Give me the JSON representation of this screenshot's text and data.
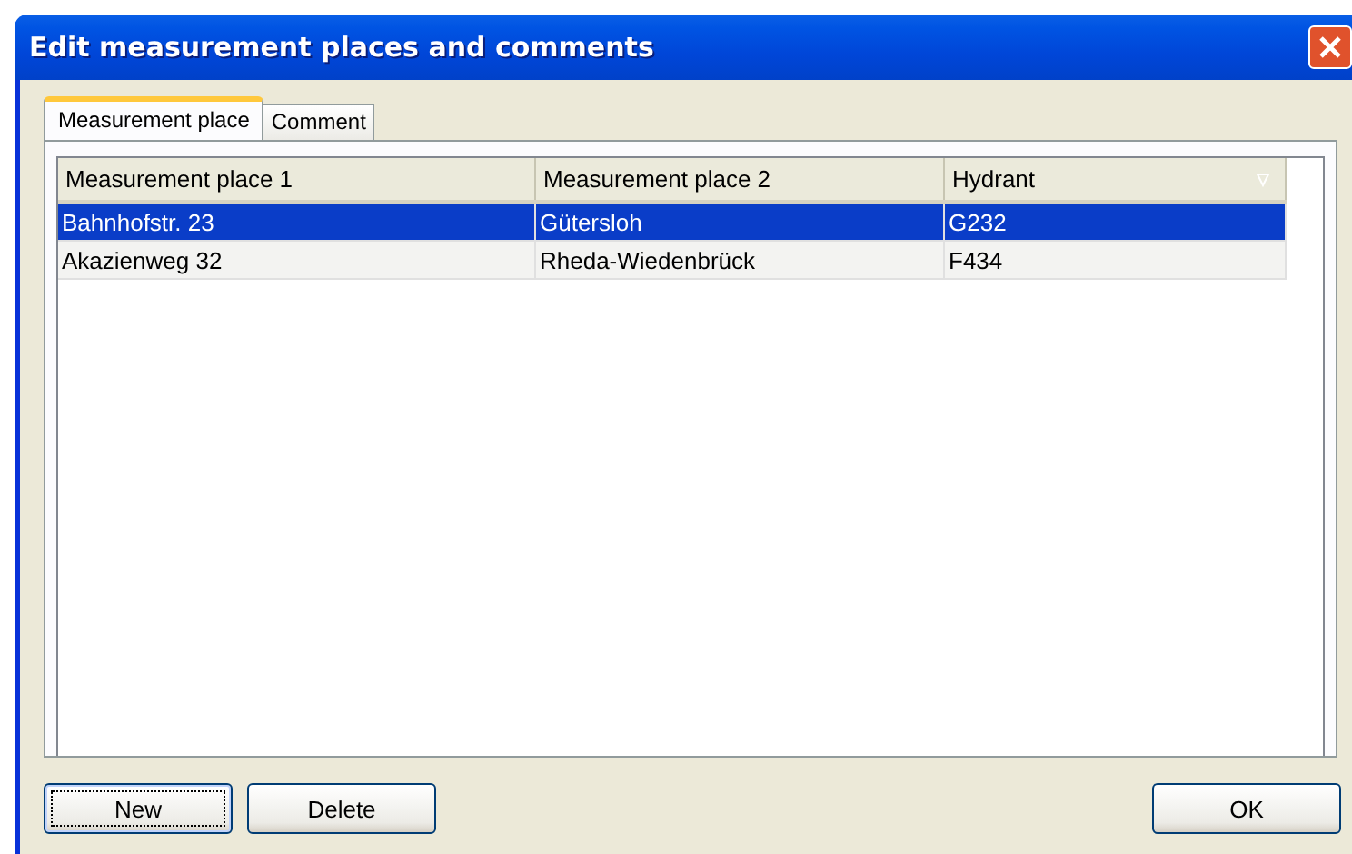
{
  "window": {
    "title": "Edit measurement places and comments"
  },
  "tabs": [
    {
      "label": "Measurement place",
      "selected": true
    },
    {
      "label": "Comment",
      "selected": false
    }
  ],
  "table": {
    "columns": [
      "Measurement place 1",
      "Measurement place 2",
      "Hydrant"
    ],
    "rows": [
      {
        "cells": [
          "Bahnhofstr. 23",
          "Gütersloh",
          "G232"
        ],
        "selected": true
      },
      {
        "cells": [
          "Akazienweg 32",
          "Rheda-Wiedenbrück",
          "F434"
        ],
        "selected": false
      }
    ]
  },
  "buttons": [
    {
      "label": "New",
      "focused": true
    },
    {
      "label": "Delete",
      "focused": false
    }
  ],
  "ok_button": {
    "label": "OK",
    "focused": false
  }
}
